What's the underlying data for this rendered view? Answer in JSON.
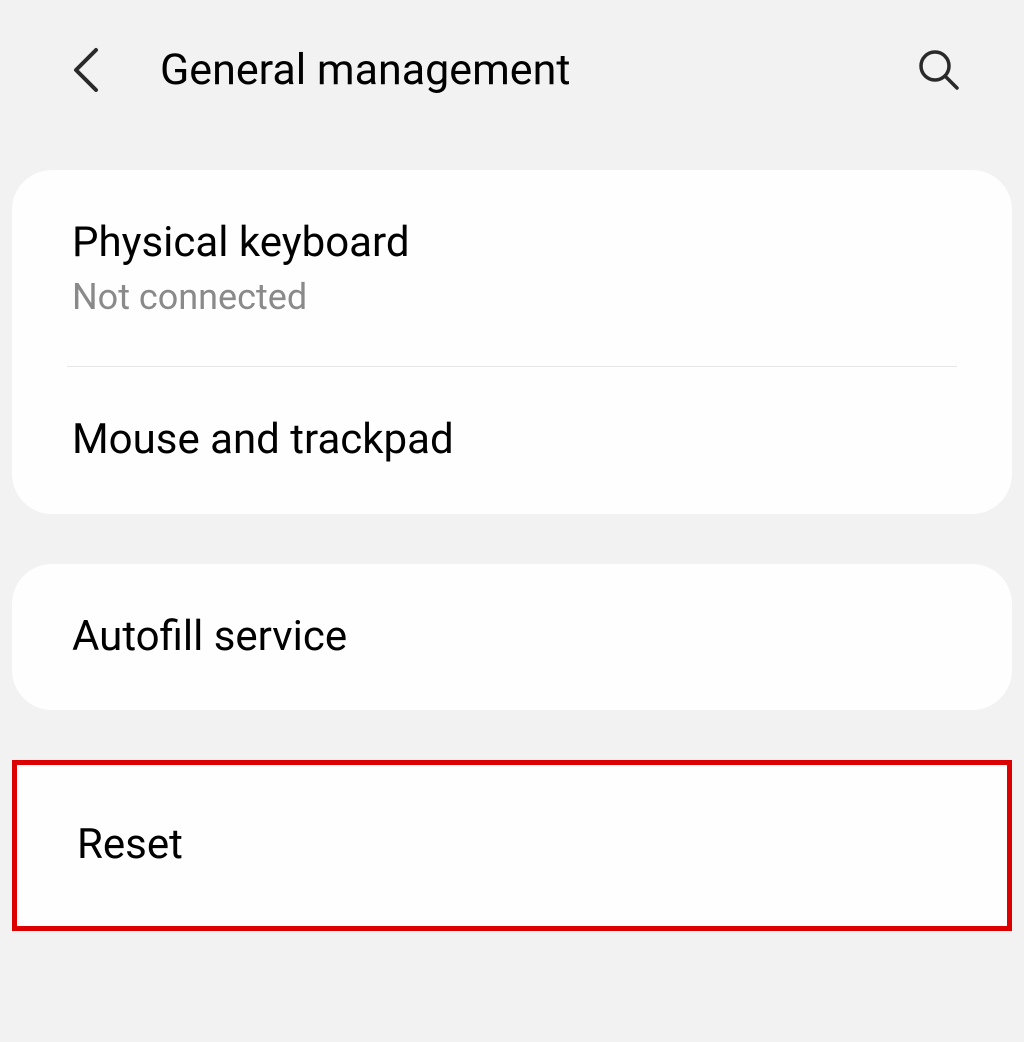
{
  "header": {
    "title": "General management"
  },
  "group1": {
    "items": [
      {
        "title": "Physical keyboard",
        "subtitle": "Not connected"
      },
      {
        "title": "Mouse and trackpad"
      }
    ]
  },
  "group2": {
    "items": [
      {
        "title": "Autofill service"
      }
    ]
  },
  "group3": {
    "items": [
      {
        "title": "Reset"
      }
    ]
  }
}
